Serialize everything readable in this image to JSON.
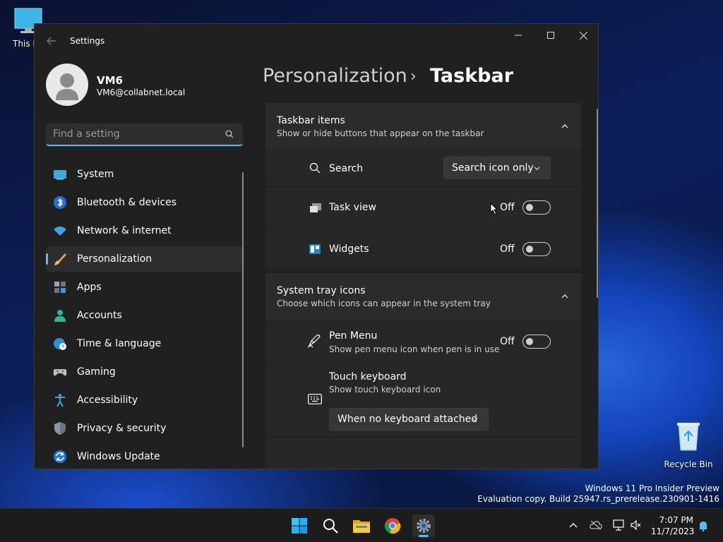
{
  "desktop": {
    "this_pc_label": "This P",
    "recycle_bin_label": "Recycle Bin",
    "watermark_line1": "Windows 11 Pro Insider Preview",
    "watermark_line2": "Evaluation copy. Build 25947.rs_prerelease.230901-1416"
  },
  "window": {
    "title": "Settings",
    "controls": {
      "minimize": "minimize-icon",
      "maximize": "maximize-icon",
      "close": "close-icon"
    }
  },
  "account": {
    "name": "VM6",
    "email": "VM6@collabnet.local"
  },
  "search": {
    "placeholder": "Find a setting",
    "value": ""
  },
  "sidebar": {
    "items": [
      {
        "label": "System",
        "icon": "monitor-icon",
        "active": false
      },
      {
        "label": "Bluetooth & devices",
        "icon": "bluetooth-icon",
        "active": false
      },
      {
        "label": "Network & internet",
        "icon": "wifi-icon",
        "active": false
      },
      {
        "label": "Personalization",
        "icon": "brush-icon",
        "active": true
      },
      {
        "label": "Apps",
        "icon": "apps-icon",
        "active": false
      },
      {
        "label": "Accounts",
        "icon": "person-icon",
        "active": false
      },
      {
        "label": "Time & language",
        "icon": "globe-clock-icon",
        "active": false
      },
      {
        "label": "Gaming",
        "icon": "gamepad-icon",
        "active": false
      },
      {
        "label": "Accessibility",
        "icon": "accessibility-icon",
        "active": false
      },
      {
        "label": "Privacy & security",
        "icon": "shield-icon",
        "active": false
      },
      {
        "label": "Windows Update",
        "icon": "update-icon",
        "active": false
      }
    ]
  },
  "breadcrumb": {
    "parent": "Personalization",
    "separator": "›",
    "current": "Taskbar"
  },
  "taskbar_items": {
    "title": "Taskbar items",
    "subtitle": "Show or hide buttons that appear on the taskbar",
    "search": {
      "label": "Search",
      "value": "Search icon only"
    },
    "task_view": {
      "label": "Task view",
      "state": "Off"
    },
    "widgets": {
      "label": "Widgets",
      "state": "Off"
    }
  },
  "system_tray": {
    "title": "System tray icons",
    "subtitle": "Choose which icons can appear in the system tray",
    "pen_menu": {
      "label": "Pen Menu",
      "description": "Show pen menu icon when pen is in use",
      "state": "Off"
    },
    "touch_keyboard": {
      "label": "Touch keyboard",
      "description": "Show touch keyboard icon",
      "value": "When no keyboard attached"
    }
  },
  "taskbar": {
    "time": "7:07 PM",
    "date": "11/7/2023"
  },
  "colors": {
    "accent": "#4cc2ff",
    "window_bg": "#202020",
    "card_bg": "#2b2b2b"
  }
}
